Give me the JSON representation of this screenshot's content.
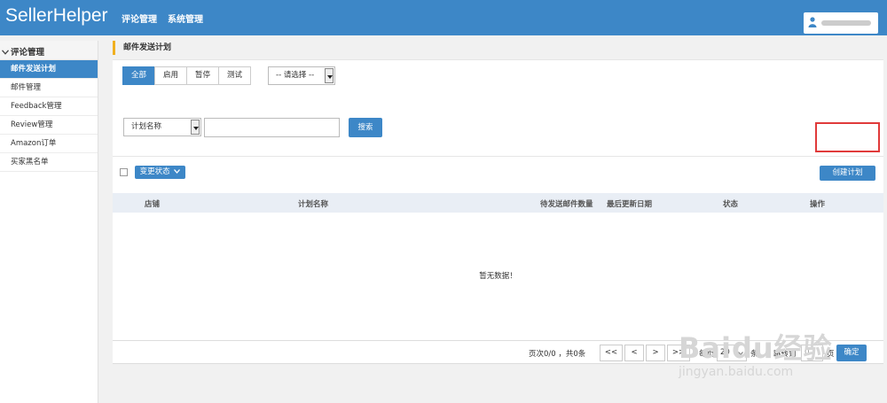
{
  "header": {
    "brand": "SellerHelper",
    "nav": [
      "评论管理",
      "系统管理"
    ]
  },
  "sidebar": {
    "group": "评论管理",
    "items": [
      {
        "label": "邮件发送计划",
        "active": true
      },
      {
        "label": "邮件管理"
      },
      {
        "label": "Feedback管理"
      },
      {
        "label": "Review管理"
      },
      {
        "label": "Amazon订单"
      },
      {
        "label": "买家黑名单"
      }
    ]
  },
  "page": {
    "title": "邮件发送计划"
  },
  "filters": {
    "tabs": [
      "全部",
      "启用",
      "暂停",
      "测试"
    ],
    "status_select": "-- 请选择 --",
    "field_select": "计划名称",
    "search_value": "",
    "search_button": "搜索"
  },
  "toolbar": {
    "change_status": "变更状态",
    "create_plan": "创建计划"
  },
  "table": {
    "columns": [
      "店铺",
      "计划名称",
      "待发送邮件数量",
      "最后更新日期",
      "状态",
      "操作"
    ],
    "empty_text": "暂无数据！"
  },
  "pager": {
    "summary": "页次0/0 ，共0条",
    "first": "<<",
    "prev": "<",
    "next": ">",
    "last": ">>",
    "per_page_label": "每页",
    "per_page_value": "20",
    "per_page_unit": "条",
    "jump_label": "跳转到",
    "jump_value": "0",
    "page_unit": "页",
    "confirm": "确定"
  },
  "watermark": {
    "brand": "Baidu经验",
    "url": "jingyan.baidu.com"
  },
  "colors": {
    "primary": "#3d87c7",
    "accent": "#f0b020",
    "highlight": "#e03a3a"
  }
}
